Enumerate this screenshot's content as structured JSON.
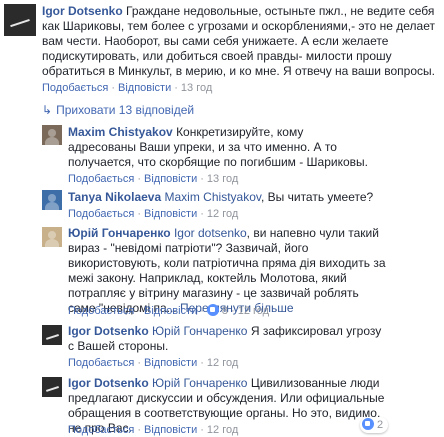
{
  "comments": [
    {
      "author": "Igor Dotsenko",
      "text": "Граждане недовольные, остыньте пжл., не ведите себя как Шариковы, тем более с угрозами и оскорблениями,- это не делает вам чести. Наоборот, вы сами себя унижаете. А если желаете подискутировать, или добиться своей правды- милости прошу обратиться в Минкульт, в мерию, и ко мне. Я отвечу на ваши вопросы.",
      "like": "Подобається",
      "reply": "Відповісти",
      "time": "13 год"
    },
    {
      "author": "Maxim Chistyakov",
      "text": "Конкретизируйте, кому адресованы Ваши упреки, и за что именно. А то получается, что скорбящие по погибшим - Шариковы.",
      "like": "Подобається",
      "reply": "Відповісти",
      "time": "13 год"
    },
    {
      "author": "Tanya Nikolaeva",
      "mention": "Maxim Chistyakov",
      "text": ", Вы читать умеете?",
      "like": "Подобається",
      "reply": "Відповісти",
      "time": "12 год"
    },
    {
      "author": "Юрій Гончаренко",
      "mention": "Igor dotsenko",
      "text": ", ви напевно чули такий вираз - \"невідомі патріоти\"? Зазвичай, його використовують, коли патріотична пряма дія виходить за межі закону. Наприклад, коктейль Молотова, який потрапляє у вітрину магазину - це зазвичай роблять саме \"невідомі па...",
      "more": "Переглянути більше",
      "like": "Подобається",
      "reply": "Відповісти",
      "reactions": "8",
      "time": "12 год"
    },
    {
      "author": "Igor Dotsenko",
      "mention": "Юрій Гончаренко",
      "text": "Я зафиксировал угрозу с Вашей стороны.",
      "like": "Подобається",
      "reply": "Відповісти",
      "time": "12 год"
    },
    {
      "author": "Igor Dotsenko",
      "mention": "Юрій Гончаренко",
      "text": "Цивилизованные люди предлагают дискуссии и обсуждения. Или официальные обращения в соответствующие органы. Но это, видимо, не про Вас.",
      "like": "Подобається",
      "reply": "Відповісти",
      "reactions": "2",
      "time": "12 год"
    }
  ],
  "replies_toggle": "Приховати 13 відповідей",
  "dot": "·"
}
